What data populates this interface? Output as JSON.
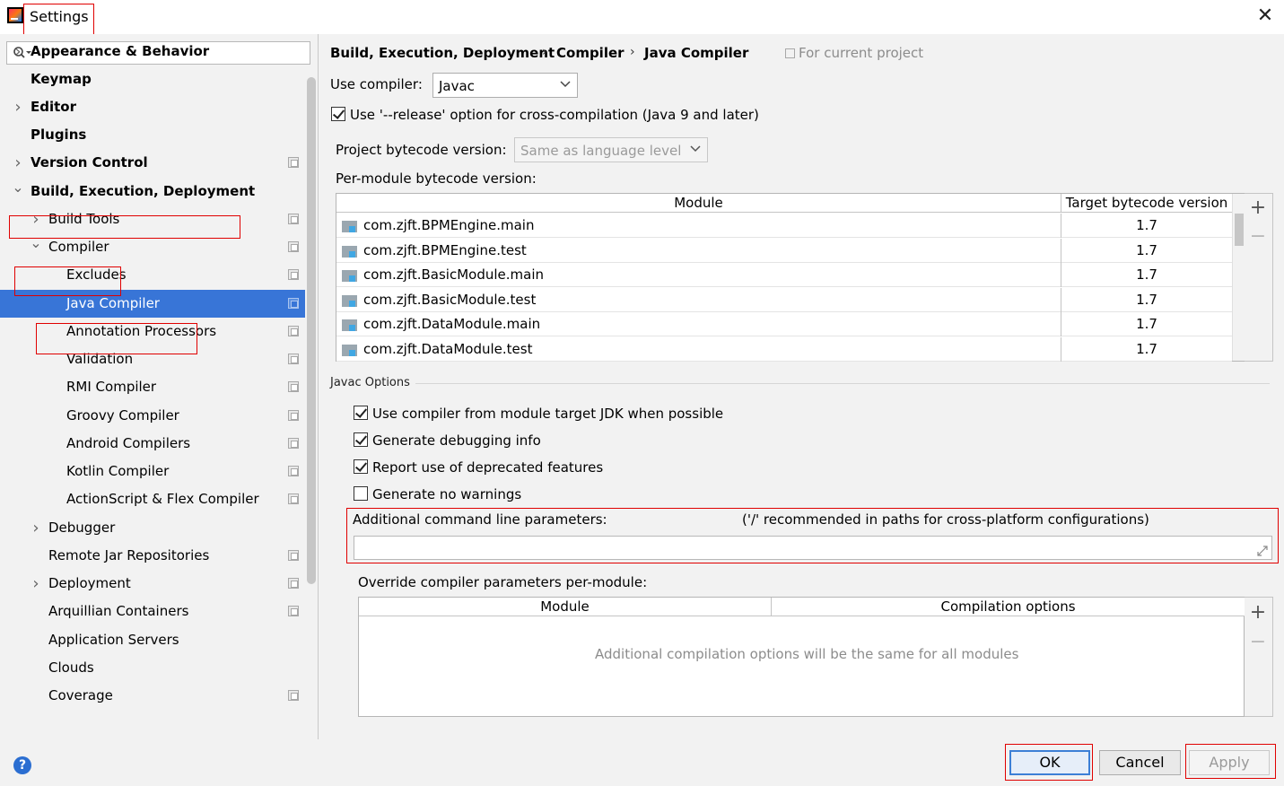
{
  "window": {
    "title": "Settings"
  },
  "search": {
    "placeholder": ""
  },
  "tree": [
    {
      "label": "Appearance & Behavior",
      "bold": true,
      "arrow": "right",
      "project": false
    },
    {
      "label": "Keymap",
      "bold": true,
      "arrow": "",
      "project": false
    },
    {
      "label": "Editor",
      "bold": true,
      "arrow": "right",
      "project": false
    },
    {
      "label": "Plugins",
      "bold": true,
      "arrow": "",
      "project": false
    },
    {
      "label": "Version Control",
      "bold": true,
      "arrow": "right",
      "project": true
    },
    {
      "label": "Build, Execution, Deployment",
      "bold": true,
      "arrow": "down",
      "project": false
    },
    {
      "label": "Build Tools",
      "bold": false,
      "arrow": "right",
      "project": true
    },
    {
      "label": "Compiler",
      "bold": false,
      "arrow": "down",
      "project": true
    },
    {
      "label": "Excludes",
      "bold": false,
      "arrow": "",
      "project": true
    },
    {
      "label": "Java Compiler",
      "bold": false,
      "arrow": "",
      "project": true,
      "selected": true
    },
    {
      "label": "Annotation Processors",
      "bold": false,
      "arrow": "",
      "project": true
    },
    {
      "label": "Validation",
      "bold": false,
      "arrow": "",
      "project": true
    },
    {
      "label": "RMI Compiler",
      "bold": false,
      "arrow": "",
      "project": true
    },
    {
      "label": "Groovy Compiler",
      "bold": false,
      "arrow": "",
      "project": true
    },
    {
      "label": "Android Compilers",
      "bold": false,
      "arrow": "",
      "project": true
    },
    {
      "label": "Kotlin Compiler",
      "bold": false,
      "arrow": "",
      "project": true
    },
    {
      "label": "ActionScript & Flex Compiler",
      "bold": false,
      "arrow": "",
      "project": true
    },
    {
      "label": "Debugger",
      "bold": false,
      "arrow": "right",
      "project": false
    },
    {
      "label": "Remote Jar Repositories",
      "bold": false,
      "arrow": "",
      "project": true
    },
    {
      "label": "Deployment",
      "bold": false,
      "arrow": "right",
      "project": true
    },
    {
      "label": "Arquillian Containers",
      "bold": false,
      "arrow": "",
      "project": true
    },
    {
      "label": "Application Servers",
      "bold": false,
      "arrow": "",
      "project": false
    },
    {
      "label": "Clouds",
      "bold": false,
      "arrow": "",
      "project": false
    },
    {
      "label": "Coverage",
      "bold": false,
      "arrow": "",
      "project": true
    }
  ],
  "breadcrumb": {
    "part1": "Build, Execution, Deployment",
    "part2": "Compiler",
    "part3": "Java Compiler",
    "sep": "›",
    "scope": "For current project"
  },
  "compiler": {
    "use_compiler_label": "Use compiler:",
    "use_compiler_value": "Javac",
    "release_option_label": "Use '--release' option for cross-compilation (Java 9 and later)",
    "release_option_checked": true,
    "bytecode_label": "Project bytecode version:",
    "bytecode_value": "Same as language level",
    "per_module_label": "Per-module bytecode version:"
  },
  "module_table": {
    "headers": {
      "module": "Module",
      "target": "Target bytecode version"
    },
    "rows": [
      {
        "module": "com.zjft.BPMEngine.main",
        "version": "1.7"
      },
      {
        "module": "com.zjft.BPMEngine.test",
        "version": "1.7"
      },
      {
        "module": "com.zjft.BasicModule.main",
        "version": "1.7"
      },
      {
        "module": "com.zjft.BasicModule.test",
        "version": "1.7"
      },
      {
        "module": "com.zjft.DataModule.main",
        "version": "1.7"
      },
      {
        "module": "com.zjft.DataModule.test",
        "version": "1.7"
      }
    ]
  },
  "javac_options": {
    "section_title": "Javac Options",
    "opt1": {
      "label": "Use compiler from module target JDK when possible",
      "checked": true
    },
    "opt2": {
      "label": "Generate debugging info",
      "checked": true
    },
    "opt3": {
      "label": "Report use of deprecated features",
      "checked": true
    },
    "opt4": {
      "label": "Generate no warnings",
      "checked": false
    },
    "cmdline_label": "Additional command line parameters:",
    "cmdline_hint": "('/' recommended in paths for cross-platform configurations)",
    "cmdline_value": "",
    "override_label": "Override compiler parameters per-module:"
  },
  "override_table": {
    "headers": {
      "module": "Module",
      "options": "Compilation options"
    },
    "empty_text": "Additional compilation options will be the same for all modules"
  },
  "tools": {
    "add": "+",
    "remove": "−"
  },
  "buttons": {
    "help": "?",
    "ok": "OK",
    "cancel": "Cancel",
    "apply": "Apply"
  },
  "colors": {
    "selection": "#3875d7",
    "highlight_box": "#e00000",
    "link_blue": "#2b6ed1"
  }
}
